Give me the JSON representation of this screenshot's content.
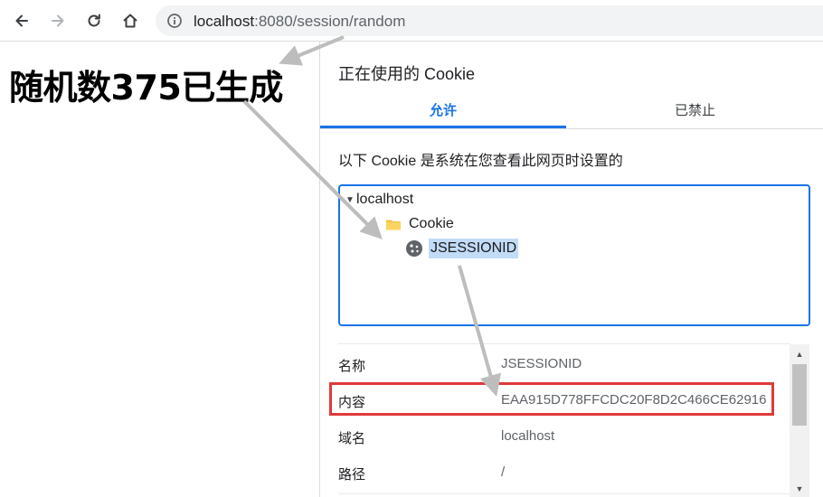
{
  "browser": {
    "url_host": "localhost",
    "url_rest": ":8080/session/random",
    "icons": [
      "back-arrow-icon",
      "forward-arrow-icon",
      "reload-icon",
      "home-icon",
      "info-icon"
    ]
  },
  "page": {
    "heading": "随机数375已生成"
  },
  "cookie_dialog": {
    "title": "正在使用的 Cookie",
    "tabs": [
      {
        "label": "允许",
        "active": true
      },
      {
        "label": "已禁止",
        "active": false
      }
    ],
    "description": "以下 Cookie 是系统在您查看此网页时设置的",
    "tree": {
      "site": "localhost",
      "folder": "Cookie",
      "cookie": "JSESSIONID"
    },
    "details": [
      {
        "label": "名称",
        "value": "JSESSIONID"
      },
      {
        "label": "内容",
        "value": "EAA915D778FFCDC20F8D2C466CE62916"
      },
      {
        "label": "域名",
        "value": "localhost"
      },
      {
        "label": "路径",
        "value": "/"
      }
    ]
  },
  "colors": {
    "accent": "#1a73e8",
    "highlight": "#e03a3a",
    "arrow": "#bdbdbd",
    "selection": "#c2dbf7"
  }
}
